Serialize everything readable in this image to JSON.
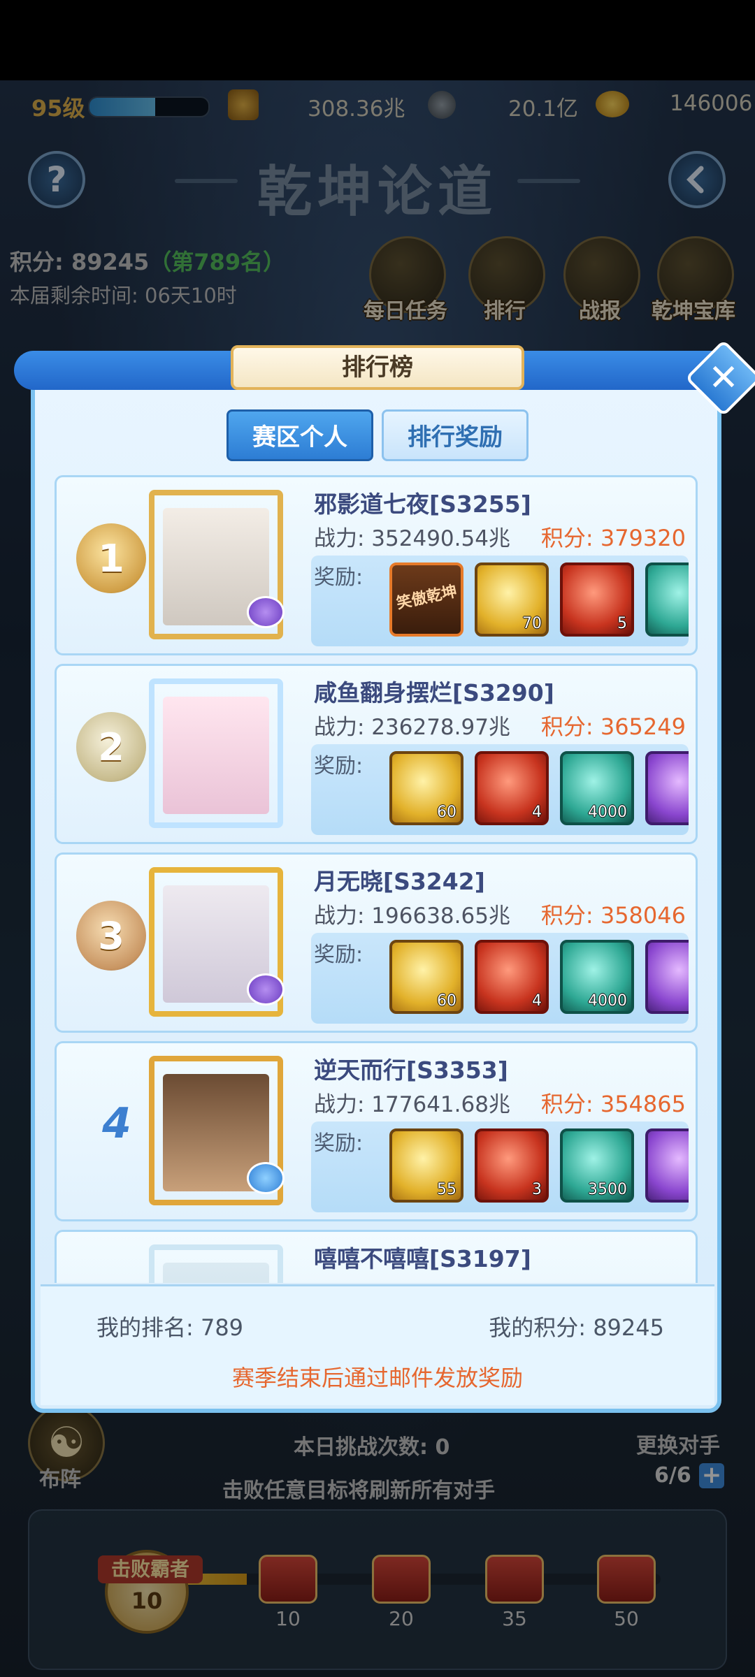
{
  "status": {
    "level": "95级",
    "level_progress": 0.55,
    "power": "308.36兆",
    "silver": "20.1亿",
    "gold": "146006"
  },
  "header": {
    "help": "?",
    "title": "乾坤论道"
  },
  "player": {
    "score_label": "积分: 89245",
    "rank_label": "（第789名）",
    "time_left": "本届剩余时间: 06天10时"
  },
  "menu": [
    "每日任务",
    "排行",
    "战报",
    "乾坤宝库"
  ],
  "modal": {
    "title": "排行榜",
    "tabs": [
      "赛区个人",
      "排行奖励"
    ],
    "reward_label": "奖励:",
    "my_rank": "我的排名: 789",
    "my_score": "我的积分: 89245",
    "notice": "赛季结束后通过邮件发放奖励"
  },
  "rows": [
    {
      "rank": "1",
      "name": "邪影道七夜[S3255]",
      "power": "战力: 352490.54兆",
      "score": "积分: 379320",
      "items": [
        {
          "type": "title",
          "text": "笑傲乾坤",
          "count": ""
        },
        {
          "type": "gold",
          "count": "70"
        },
        {
          "type": "red",
          "count": "5"
        },
        {
          "type": "teal",
          "count": ""
        }
      ]
    },
    {
      "rank": "2",
      "name": "咸鱼翻身摆烂[S3290]",
      "power": "战力: 236278.97兆",
      "score": "积分: 365249",
      "items": [
        {
          "type": "gold",
          "count": "60"
        },
        {
          "type": "red",
          "count": "4"
        },
        {
          "type": "teal",
          "count": "4000"
        },
        {
          "type": "purple",
          "count": ""
        }
      ]
    },
    {
      "rank": "3",
      "name": "月无晓[S3242]",
      "power": "战力: 196638.65兆",
      "score": "积分: 358046",
      "items": [
        {
          "type": "gold",
          "count": "60"
        },
        {
          "type": "red",
          "count": "4"
        },
        {
          "type": "teal",
          "count": "4000"
        },
        {
          "type": "purple",
          "count": ""
        }
      ]
    },
    {
      "rank": "4",
      "name": "逆天而行[S3353]",
      "power": "战力: 177641.68兆",
      "score": "积分: 354865",
      "items": [
        {
          "type": "gold",
          "count": "55"
        },
        {
          "type": "red",
          "count": "3"
        },
        {
          "type": "teal",
          "count": "3500"
        },
        {
          "type": "purple",
          "count": ""
        }
      ]
    },
    {
      "rank": "",
      "name": "嘻嘻不嘻嘻[S3197]",
      "power": "",
      "score": "",
      "items": []
    }
  ],
  "bottom": {
    "formation": "布阵",
    "challenges": "本日挑战次数: 0",
    "swap": "更换对手",
    "refresh_tip": "击败任意目标将刷新所有对手",
    "swap_count": "6/6",
    "boss_tag": "击败霸者",
    "boss_count": "10",
    "milestones": [
      "10",
      "20",
      "35",
      "50"
    ],
    "progress": 0.2
  },
  "colors": {
    "accent_blue": "#2d7dd4",
    "score_orange": "#e6672f",
    "rank_green": "#55c25d"
  }
}
